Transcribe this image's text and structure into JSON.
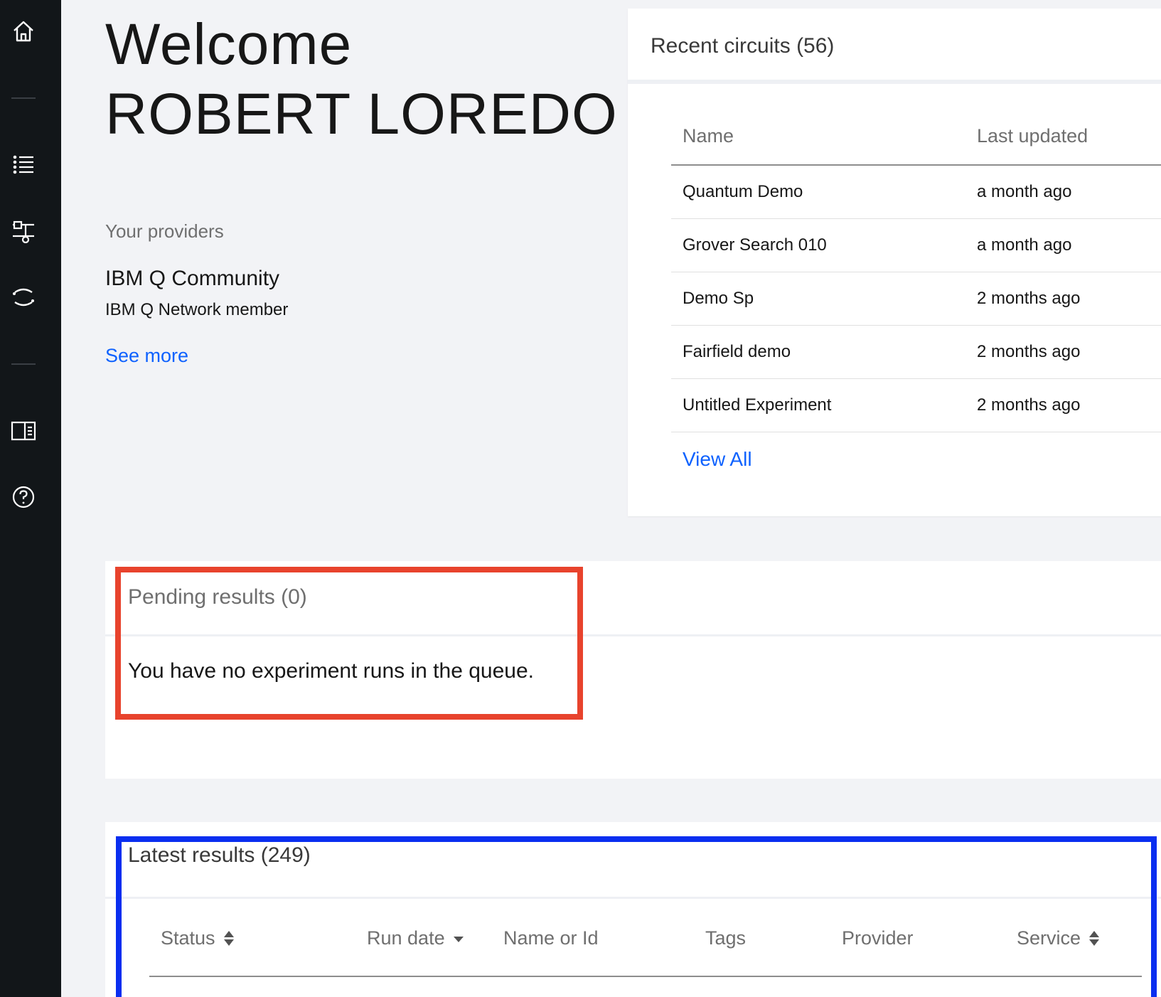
{
  "sidebar": {
    "items": [
      {
        "icon": "home-icon"
      },
      {
        "icon": "list-icon"
      },
      {
        "icon": "circuit-composer-icon"
      },
      {
        "icon": "quantum-lab-icon"
      },
      {
        "icon": "docs-icon"
      },
      {
        "icon": "help-icon"
      }
    ]
  },
  "welcome": {
    "line1": "Welcome",
    "line2": "ROBERT LOREDO"
  },
  "providers": {
    "label": "Your providers",
    "name": "IBM Q Community",
    "role": "IBM Q Network member",
    "see_more": "See more"
  },
  "recent_circuits": {
    "title": "Recent circuits (56)",
    "columns": [
      "Name",
      "Last updated"
    ],
    "rows": [
      {
        "name": "Quantum Demo",
        "updated": "a month ago"
      },
      {
        "name": "Grover Search 010",
        "updated": "a month ago"
      },
      {
        "name": "Demo Sp",
        "updated": "2 months ago"
      },
      {
        "name": "Fairfield demo",
        "updated": "2 months ago"
      },
      {
        "name": "Untitled Experiment",
        "updated": "2 months ago"
      }
    ],
    "view_all": "View All"
  },
  "pending": {
    "title": "Pending results (0)",
    "empty_message": "You have no experiment runs in the queue."
  },
  "latest": {
    "title": "Latest results (249)",
    "columns": [
      {
        "label": "Status",
        "sort": "both"
      },
      {
        "label": "Run date",
        "sort": "desc"
      },
      {
        "label": "Name or Id",
        "sort": "none"
      },
      {
        "label": "Tags",
        "sort": "none"
      },
      {
        "label": "Provider",
        "sort": "none"
      },
      {
        "label": "Service",
        "sort": "both"
      }
    ]
  },
  "colors": {
    "accent": "#0f62fe",
    "sidebar": "#121619",
    "highlight_red": "#e8432d",
    "highlight_blue": "#0a2ef0"
  }
}
